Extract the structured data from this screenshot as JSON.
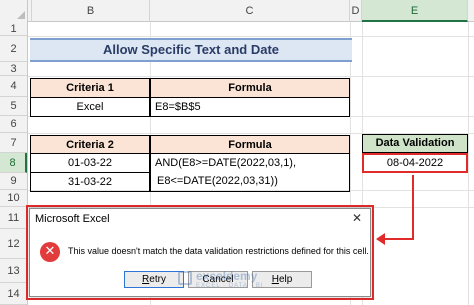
{
  "sheet": {
    "columns": [
      "B",
      "C",
      "D",
      "E"
    ],
    "selected_column": "E",
    "rows": [
      "1",
      "2",
      "3",
      "4",
      "5",
      "6",
      "7",
      "8",
      "9",
      "10",
      "11",
      "12",
      "13",
      "14"
    ],
    "selected_row": "8"
  },
  "banner": {
    "title": "Allow Specific Text and Date"
  },
  "table1": {
    "headers": [
      "Criteria 1",
      "Formula"
    ],
    "criteria": "Excel",
    "formula": "E8=$B$5"
  },
  "table2": {
    "headers": [
      "Criteria 2",
      "Formula"
    ],
    "dates": [
      "01-03-22",
      "31-03-22"
    ],
    "formula_line1": "AND(E8>=DATE(2022,03,1),",
    "formula_line2": "E8<=DATE(2022,03,31))"
  },
  "data_validation": {
    "header": "Data Validation",
    "value": "08-04-2022"
  },
  "dialog": {
    "title": "Microsoft Excel",
    "close_glyph": "✕",
    "error_glyph": "✕",
    "message": "This value doesn't match the data validation restrictions defined for this cell.",
    "buttons": {
      "retry": {
        "accel": "R",
        "rest": "etry"
      },
      "cancel": {
        "accel": "",
        "rest": "Cancel"
      },
      "help": {
        "accel": "H",
        "rest": "elp"
      }
    }
  },
  "watermark": {
    "name": "exceldemy",
    "sub": "EXCEL · DATA · BI"
  },
  "colors": {
    "highlight": "#e02b2b",
    "header_fill": "#fbe4d5",
    "dv_fill": "#cfe3c8",
    "banner_fill": "#dde6f3"
  }
}
